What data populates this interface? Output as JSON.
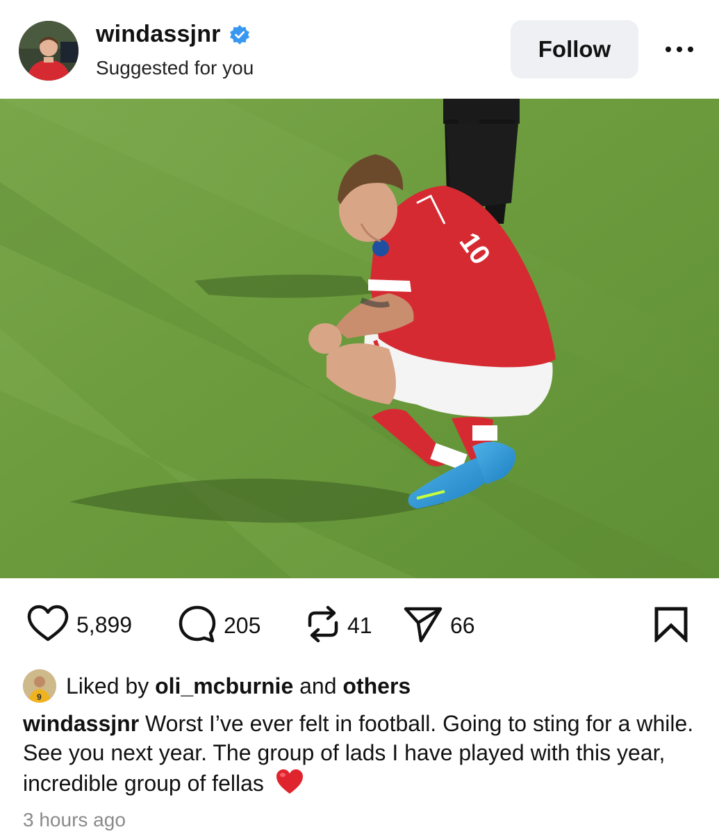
{
  "post": {
    "username": "windassjnr",
    "subtitle": "Suggested for you",
    "follow_label": "Follow",
    "verified": true,
    "likes": "5,899",
    "comments": "205",
    "reposts": "41",
    "shares": "66",
    "liked_by_prefix": "Liked by",
    "liked_by_user": "oli_mcburnie",
    "liked_by_and": "and",
    "liked_by_others": "others",
    "caption_user": "windassjnr",
    "caption_text": "Worst I’ve ever felt in football. Going to sting for a while. See you next year. The group of lads I have played with this year, incredible group of fellas",
    "timestamp": "3 hours ago"
  },
  "icons": {
    "verified": "verified-badge-icon",
    "more": "more-options-icon",
    "like": "heart-icon",
    "comment": "comment-bubble-icon",
    "repost": "repost-icon",
    "share": "paper-plane-icon",
    "save": "bookmark-icon",
    "caption_emoji": "red-heart-emoji"
  },
  "colors": {
    "verified_blue": "#3897f0",
    "follow_bg": "#eef0f3",
    "timestamp_gray": "#8a8a8a",
    "emoji_red": "#e0242d",
    "pitch_green": "#6f9a3f",
    "kit_red": "#d62a32"
  }
}
